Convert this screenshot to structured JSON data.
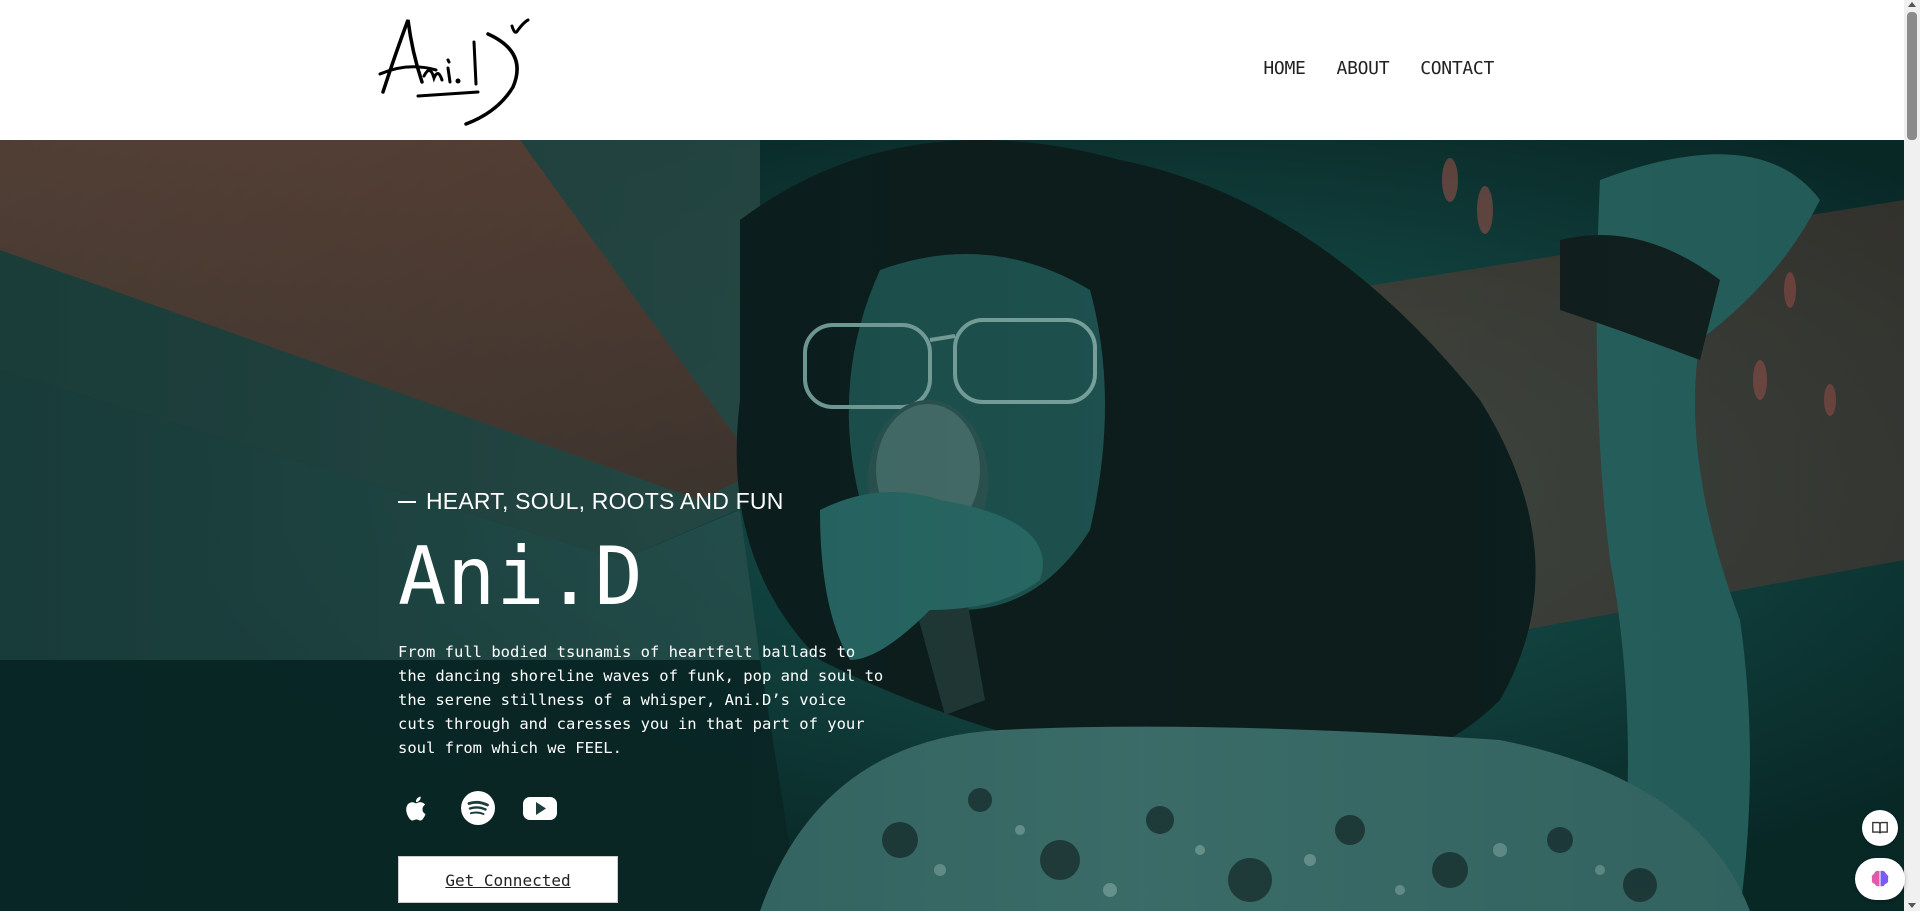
{
  "header": {
    "logo_text": "Ani.D",
    "nav": [
      {
        "label": "HOME"
      },
      {
        "label": "ABOUT"
      },
      {
        "label": "CONTACT"
      }
    ]
  },
  "hero": {
    "tagline": "HEART, SOUL, ROOTS AND FUN",
    "title": "Ani.D",
    "description": "From full bodied tsunamis of heartfelt ballads to the dancing shoreline waves of funk, pop and soul to the serene stillness of a whisper, Ani.D’s voice cuts through and caresses you in that part of your soul from which we FEEL.",
    "socials": [
      {
        "icon": "apple-music-icon"
      },
      {
        "icon": "spotify-icon"
      },
      {
        "icon": "youtube-icon"
      }
    ],
    "cta_label": "Get Connected"
  },
  "colors": {
    "hero_tint": "#0c2b2a",
    "teal": "#1f6a66",
    "brick": "#7a4536",
    "white": "#ffffff"
  },
  "floating": [
    {
      "icon": "reader-book-icon"
    },
    {
      "icon": "brain-icon"
    }
  ]
}
